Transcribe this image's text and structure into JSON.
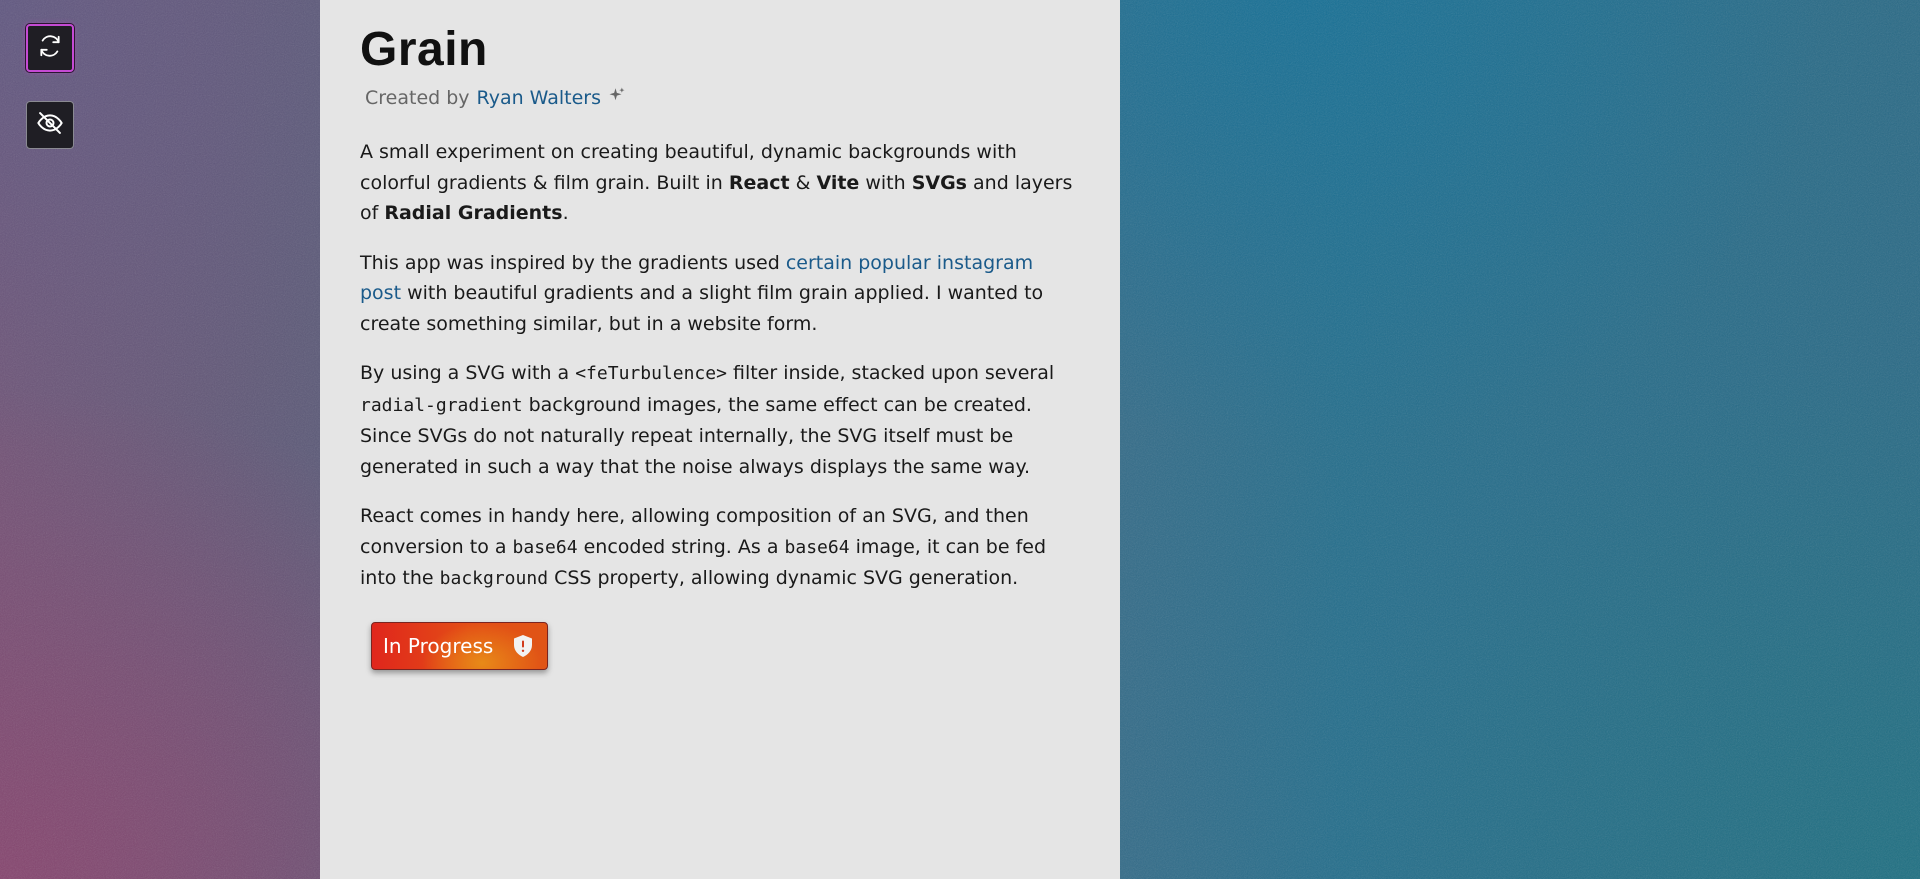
{
  "app": {
    "title": "Grain",
    "byline_prefix": "Created by",
    "author": "Ryan Walters"
  },
  "sidebar": {
    "buttons": [
      {
        "name": "refresh",
        "icon": "refresh-icon",
        "active": true
      },
      {
        "name": "hide",
        "icon": "eye-off-icon",
        "active": false
      }
    ]
  },
  "content": {
    "p1": {
      "t1": "A small experiment on creating beautiful, dynamic backgrounds with colorful gradients & film grain. Built in ",
      "b1": "React",
      "t2": " & ",
      "b2": "Vite",
      "t3": " with ",
      "b3": "SVGs",
      "t4": " and layers of ",
      "b4": "Radial Gradients",
      "t5": "."
    },
    "p2": {
      "t1": "This app was inspired by the gradients used ",
      "link": "certain popular instagram post",
      "t2": " with beautiful gradients and a slight film grain applied. I wanted to create something similar, but in a website form."
    },
    "p3": {
      "t1": "By using a SVG with a ",
      "c1": "<feTurbulence>",
      "t2": " filter inside, stacked upon several ",
      "c2": "radial-gradient",
      "t3": " background images, the same effect can be created. Since SVGs do not naturally repeat internally, the SVG itself must be generated in such a way that the noise always displays the same way."
    },
    "p4": {
      "t1": "React comes in handy here, allowing composition of an SVG, and then conversion to a ",
      "c1": "base64",
      "t2": " encoded string. As a ",
      "c2": "base64",
      "t3": " image, it can be fed into the ",
      "c3": "background",
      "t4": " CSS property, allowing dynamic SVG generation."
    }
  },
  "status_badge": {
    "label": "In Progress",
    "icon": "shield-alert-icon"
  },
  "colors": {
    "panel_bg": "#e5e5e5",
    "link": "#1a5a8a",
    "badge_red": "#e0261c",
    "badge_orange": "#e88a18",
    "active_outline": "#c54ad4"
  }
}
